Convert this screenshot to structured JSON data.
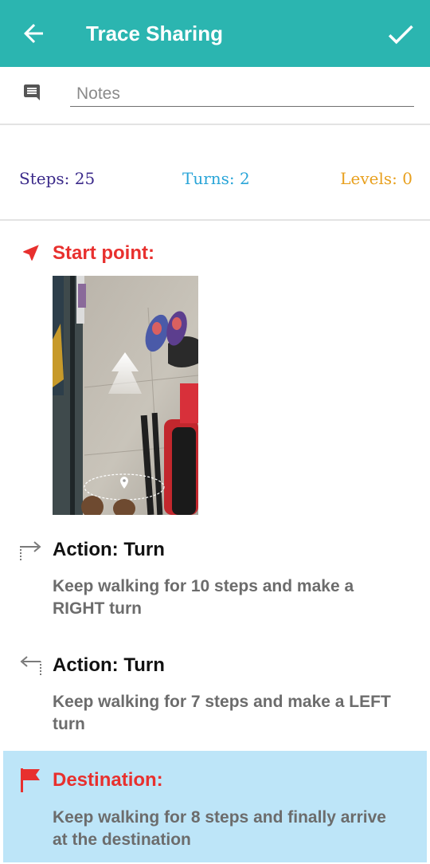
{
  "app_bar": {
    "title": "Trace Sharing",
    "back_icon": "arrow-back-icon",
    "confirm_icon": "checkmark-icon",
    "color": "#2bb5b0"
  },
  "notes": {
    "placeholder": "Notes",
    "icon": "comment-icon"
  },
  "stats": {
    "steps": "Steps: 25",
    "turns": "Turns: 2",
    "levels": "Levels: 0"
  },
  "trace": {
    "start": {
      "title": "Start point:",
      "icon": "navigation-arrow-icon",
      "photo": "start-point-photo"
    },
    "actions": [
      {
        "title": "Action: Turn",
        "description": "Keep walking for 10 steps and make a RIGHT turn",
        "icon": "turn-right-icon"
      },
      {
        "title": "Action: Turn",
        "description": "Keep walking for 7 steps and make a LEFT turn",
        "icon": "turn-left-icon"
      }
    ],
    "destination": {
      "title": "Destination:",
      "description": "Keep walking for 8 steps and finally arrive at the destination",
      "icon": "flag-icon",
      "highlight_color": "#bde5f8"
    }
  }
}
